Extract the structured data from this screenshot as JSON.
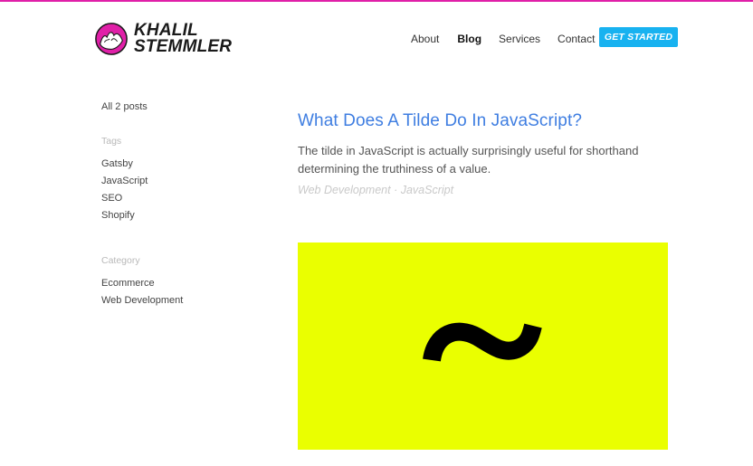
{
  "brand": {
    "line1": "KHALIL",
    "line2": "STEMMLER",
    "accent": "#e020a8"
  },
  "nav": {
    "about": "About",
    "blog": "Blog",
    "services": "Services",
    "contact": "Contact",
    "cta": "GET STARTED",
    "cta_color": "#18b2f0"
  },
  "sidebar": {
    "all_posts": "All 2 posts",
    "tags_title": "Tags",
    "tags": [
      "Gatsby",
      "JavaScript",
      "SEO",
      "Shopify"
    ],
    "category_title": "Category",
    "categories": [
      "Ecommerce",
      "Web Development"
    ]
  },
  "post": {
    "title": "What Does A Tilde Do In JavaScript?",
    "excerpt": "The tilde in JavaScript is actually surprisingly useful for shorthand determining the truthiness of a value.",
    "meta": "Web Development · JavaScript",
    "title_color": "#3f7ee1"
  },
  "hero": {
    "background": "#eaff00",
    "symbol": "tilde-icon"
  }
}
